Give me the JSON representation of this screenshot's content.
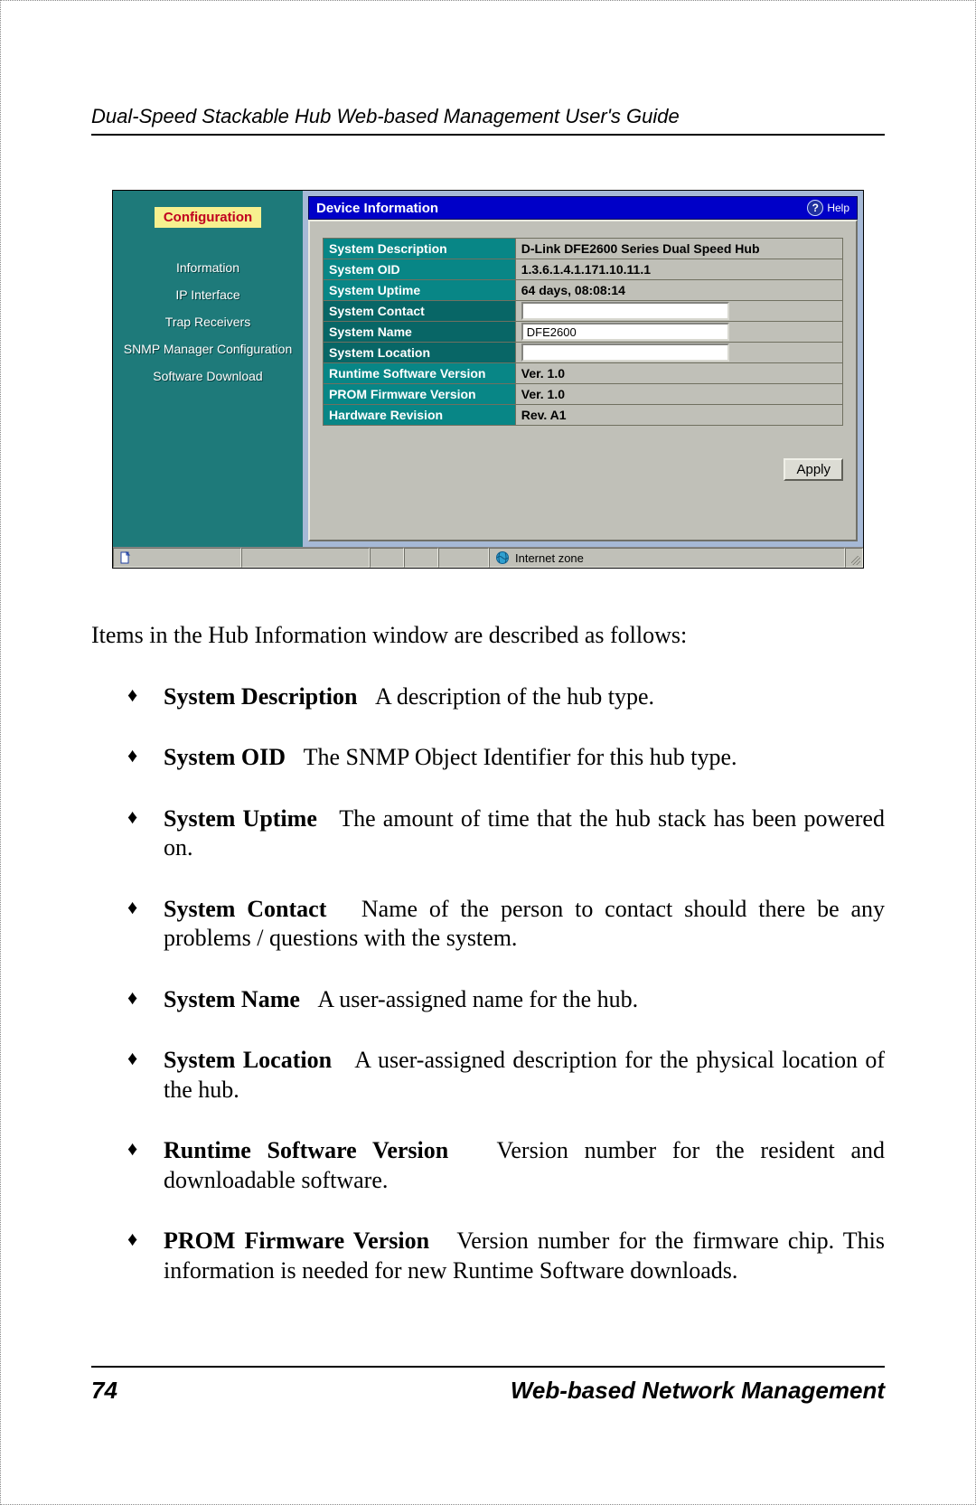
{
  "header_title": "Dual-Speed Stackable Hub Web-based Management User's Guide",
  "screenshot": {
    "sidebar_header": "Configuration",
    "sidebar_items": [
      "Information",
      "IP Interface",
      "Trap Receivers",
      "SNMP Manager Configuration",
      "Software Download"
    ],
    "titlebar": "Device Information",
    "help_label": "Help",
    "rows": [
      {
        "label": "System Description",
        "value": "D-Link DFE2600 Series Dual Speed Hub",
        "type": "ro"
      },
      {
        "label": "System OID",
        "value": "1.3.6.1.4.1.171.10.11.1",
        "type": "ro"
      },
      {
        "label": "System Uptime",
        "value": "64 days, 08:08:14",
        "type": "ro"
      },
      {
        "label": "System Contact",
        "value": "",
        "type": "edit"
      },
      {
        "label": "System Name",
        "value": "DFE2600",
        "type": "edit"
      },
      {
        "label": "System Location",
        "value": "",
        "type": "edit"
      },
      {
        "label": "Runtime Software Version",
        "value": "Ver. 1.0",
        "type": "ro"
      },
      {
        "label": "PROM Firmware Version",
        "value": "Ver. 1.0",
        "type": "ro"
      },
      {
        "label": "Hardware Revision",
        "value": "Rev. A1",
        "type": "ro"
      }
    ],
    "apply_label": "Apply",
    "status_zone": "Internet zone"
  },
  "intro": "Items in the Hub Information window are described as follows:",
  "bullets": [
    {
      "term": "System Description",
      "desc": "A description of the hub type."
    },
    {
      "term": "System OID",
      "desc": "The SNMP Object Identifier for this hub type."
    },
    {
      "term": "System Uptime",
      "desc": "The amount of time that the hub stack has been powered on."
    },
    {
      "term": "System Contact",
      "desc": "Name of the person to contact should there be any problems / questions with the system."
    },
    {
      "term": "System Name",
      "desc": "A user-assigned name for the hub."
    },
    {
      "term": "System Location",
      "desc": "A user-assigned description for the physical location of the hub."
    },
    {
      "term": "Runtime Software Version",
      "desc": "Version number for the resident and downloadable software."
    },
    {
      "term": "PROM Firmware Version",
      "desc": "Version number for the firmware chip. This information is needed for new Runtime Software downloads."
    }
  ],
  "footer": {
    "page": "74",
    "section": "Web-based Network Management"
  }
}
